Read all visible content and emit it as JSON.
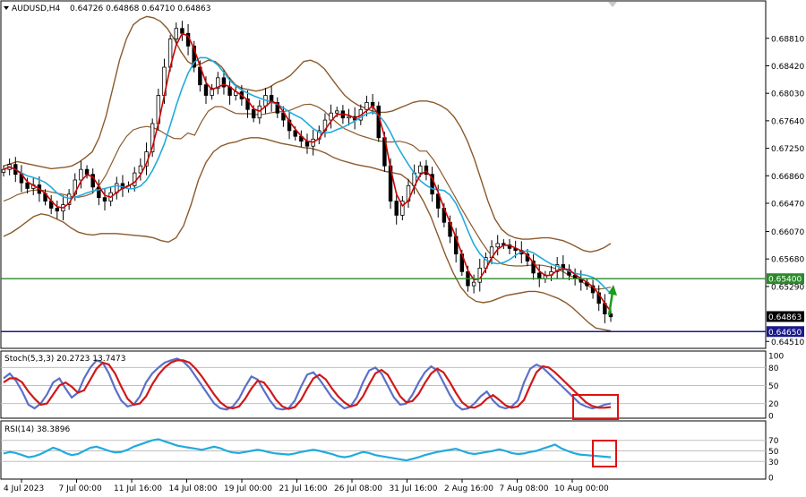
{
  "header": {
    "symbol": "AUDUSD,H4",
    "ohlc": "0.64726 0.64868 0.64710 0.64863",
    "menu_icon": "triangle-down-icon"
  },
  "colors": {
    "candle": "#000000",
    "ma_fast": "#cc0000",
    "ma_slow": "#22aadd",
    "bollinger": "#8b5a2b",
    "support_line": "#2a8a2a",
    "low_line": "#1a1a8a",
    "stoch_main": "#5a70c8",
    "stoch_signal": "#d01818",
    "rsi": "#22aadd",
    "highlight_box": "#e01010",
    "arrow": "#1e9a1e"
  },
  "chart_data": [
    {
      "type": "candlestick",
      "symbol": "AUDUSD",
      "timeframe": "H4",
      "ylim": [
        0.6445,
        0.6915
      ],
      "y_ticks": [
        "0.68810",
        "0.68420",
        "0.68030",
        "0.67640",
        "0.67250",
        "0.66860",
        "0.66470",
        "0.66070",
        "0.65680",
        "0.65290",
        "0.64510"
      ],
      "x_ticks": [
        "4 Jul 2023",
        "7 Jul 00:00",
        "11 Jul 16:00",
        "14 Jul 08:00",
        "19 Jul 00:00",
        "21 Jul 16:00",
        "26 Jul 08:00",
        "31 Jul 16:00",
        "2 Aug 16:00",
        "7 Aug 08:00",
        "10 Aug 00:00"
      ],
      "horizontal_lines": [
        {
          "value": 0.654,
          "label": "0.65400"
        },
        {
          "value": 0.6465,
          "label": "0.64650"
        }
      ],
      "current_price": {
        "value": 0.64863,
        "label": "0.64863"
      },
      "closes": [
        0.6695,
        0.6702,
        0.6688,
        0.6676,
        0.6668,
        0.6673,
        0.6661,
        0.665,
        0.664,
        0.6636,
        0.6645,
        0.666,
        0.668,
        0.6695,
        0.6688,
        0.667,
        0.6655,
        0.665,
        0.6662,
        0.6675,
        0.6668,
        0.6672,
        0.669,
        0.67,
        0.672,
        0.676,
        0.68,
        0.684,
        0.688,
        0.6895,
        0.6888,
        0.687,
        0.684,
        0.6815,
        0.68,
        0.681,
        0.6825,
        0.6812,
        0.68,
        0.6805,
        0.6795,
        0.678,
        0.6768,
        0.6785,
        0.68,
        0.679,
        0.6775,
        0.6765,
        0.675,
        0.6742,
        0.6735,
        0.6728,
        0.6738,
        0.675,
        0.6765,
        0.6775,
        0.6778,
        0.6768,
        0.677,
        0.6765,
        0.678,
        0.679,
        0.6785,
        0.674,
        0.67,
        0.665,
        0.663,
        0.665,
        0.6672,
        0.669,
        0.67,
        0.6688,
        0.666,
        0.664,
        0.662,
        0.66,
        0.6575,
        0.655,
        0.653,
        0.6535,
        0.6555,
        0.657,
        0.6585,
        0.659,
        0.6588,
        0.6583,
        0.658,
        0.6575,
        0.6565,
        0.6548,
        0.654,
        0.6545,
        0.655,
        0.656,
        0.6553,
        0.6545,
        0.654,
        0.6535,
        0.653,
        0.652,
        0.6505,
        0.649,
        0.6486
      ],
      "bollinger_upper": [
        0.67,
        0.6703,
        0.6706,
        0.6704,
        0.6702,
        0.67,
        0.6698,
        0.6696,
        0.6697,
        0.6698,
        0.67,
        0.6705,
        0.6712,
        0.672,
        0.674,
        0.677,
        0.681,
        0.685,
        0.688,
        0.69,
        0.6908,
        0.6912,
        0.691,
        0.6905,
        0.6895,
        0.688,
        0.6862,
        0.6848,
        0.6842,
        0.6845,
        0.685,
        0.6848,
        0.684,
        0.6826,
        0.6815,
        0.681,
        0.6808,
        0.6806,
        0.6808,
        0.6812,
        0.6818,
        0.6822,
        0.6828,
        0.6838,
        0.6848,
        0.685,
        0.6846,
        0.6838,
        0.6825,
        0.6812,
        0.68,
        0.6792,
        0.6786,
        0.6782,
        0.6778,
        0.6776,
        0.6776,
        0.6778,
        0.6782,
        0.6786,
        0.679,
        0.6792,
        0.6792,
        0.679,
        0.6786,
        0.678,
        0.677,
        0.6755,
        0.6735,
        0.671,
        0.668,
        0.665,
        0.6625,
        0.661,
        0.6602,
        0.6598,
        0.6596,
        0.6596,
        0.6597,
        0.6598,
        0.6598,
        0.6596,
        0.6594,
        0.659,
        0.6585,
        0.658,
        0.6578,
        0.658,
        0.6584,
        0.659
      ],
      "bollinger_lower": [
        0.66,
        0.6605,
        0.6612,
        0.662,
        0.6628,
        0.6632,
        0.663,
        0.6625,
        0.662,
        0.6612,
        0.6606,
        0.6603,
        0.6602,
        0.6604,
        0.6604,
        0.6604,
        0.6603,
        0.6602,
        0.6601,
        0.66,
        0.6598,
        0.6594,
        0.6592,
        0.6598,
        0.6615,
        0.6645,
        0.668,
        0.6705,
        0.672,
        0.6728,
        0.6732,
        0.6734,
        0.6738,
        0.674,
        0.674,
        0.6738,
        0.6735,
        0.6732,
        0.673,
        0.6728,
        0.6726,
        0.6725,
        0.6722,
        0.6718,
        0.6712,
        0.6708,
        0.6705,
        0.6702,
        0.67,
        0.6698,
        0.6695,
        0.6692,
        0.669,
        0.6688,
        0.668,
        0.6668,
        0.665,
        0.6628,
        0.66,
        0.6572,
        0.6548,
        0.6528,
        0.6515,
        0.6508,
        0.6506,
        0.6508,
        0.6512,
        0.6516,
        0.6518,
        0.652,
        0.6522,
        0.6522,
        0.652,
        0.6516,
        0.6512,
        0.6506,
        0.6498,
        0.6488,
        0.6478,
        0.647,
        0.6468,
        0.6466
      ]
    },
    {
      "type": "line",
      "title": "Stoch(5,3,3) 20.2723 13.7473",
      "ylim": [
        0,
        100
      ],
      "y_ticks": [
        "100",
        "80",
        "50",
        "20",
        "0"
      ],
      "series": [
        {
          "name": "Stoch main",
          "values": [
            62,
            70,
            58,
            40,
            18,
            12,
            20,
            35,
            55,
            62,
            45,
            30,
            38,
            62,
            80,
            92,
            88,
            70,
            45,
            25,
            15,
            18,
            32,
            55,
            70,
            80,
            88,
            92,
            95,
            90,
            80,
            65,
            50,
            35,
            20,
            12,
            10,
            15,
            28,
            48,
            65,
            60,
            42,
            25,
            12,
            10,
            12,
            25,
            48,
            68,
            72,
            60,
            45,
            30,
            20,
            12,
            15,
            30,
            55,
            75,
            80,
            70,
            50,
            30,
            18,
            20,
            35,
            55,
            72,
            82,
            75,
            55,
            35,
            18,
            10,
            12,
            20,
            32,
            40,
            25,
            15,
            12,
            15,
            25,
            55,
            78,
            85,
            80,
            70,
            60,
            50,
            40,
            30,
            20,
            15,
            12,
            14,
            18,
            20
          ]
        },
        {
          "name": "Stoch signal",
          "values": [
            55,
            62,
            62,
            55,
            40,
            28,
            18,
            20,
            35,
            50,
            55,
            48,
            38,
            42,
            60,
            78,
            88,
            85,
            70,
            48,
            28,
            18,
            20,
            32,
            52,
            68,
            80,
            88,
            92,
            92,
            88,
            78,
            65,
            50,
            35,
            22,
            14,
            12,
            15,
            28,
            45,
            58,
            55,
            42,
            26,
            15,
            11,
            14,
            26,
            45,
            62,
            68,
            60,
            45,
            32,
            22,
            15,
            18,
            32,
            52,
            70,
            76,
            68,
            50,
            32,
            22,
            24,
            36,
            54,
            70,
            78,
            72,
            56,
            38,
            22,
            14,
            13,
            18,
            28,
            34,
            26,
            17,
            13,
            15,
            26,
            50,
            72,
            82,
            80,
            72,
            62,
            52,
            42,
            32,
            22,
            16,
            13,
            13,
            14
          ]
        }
      ]
    },
    {
      "type": "line",
      "title": "RSI(14) 38.3896",
      "ylim": [
        0,
        100
      ],
      "y_ticks": [
        "70",
        "50",
        "30",
        "0"
      ],
      "series": [
        {
          "name": "RSI",
          "values": [
            45,
            48,
            46,
            42,
            38,
            40,
            44,
            50,
            56,
            52,
            46,
            42,
            44,
            50,
            56,
            58,
            54,
            50,
            47,
            48,
            52,
            58,
            62,
            66,
            70,
            72,
            68,
            64,
            60,
            58,
            56,
            54,
            52,
            55,
            58,
            55,
            50,
            47,
            46,
            48,
            50,
            52,
            50,
            47,
            45,
            44,
            43,
            45,
            48,
            50,
            52,
            50,
            47,
            44,
            40,
            38,
            40,
            44,
            48,
            46,
            42,
            40,
            38,
            36,
            34,
            32,
            35,
            38,
            42,
            45,
            48,
            50,
            52,
            54,
            50,
            46,
            44,
            46,
            48,
            50,
            53,
            50,
            46,
            44,
            45,
            48,
            50,
            54,
            58,
            62,
            55,
            50,
            46,
            43,
            42,
            41,
            40,
            39,
            38
          ]
        }
      ]
    }
  ]
}
